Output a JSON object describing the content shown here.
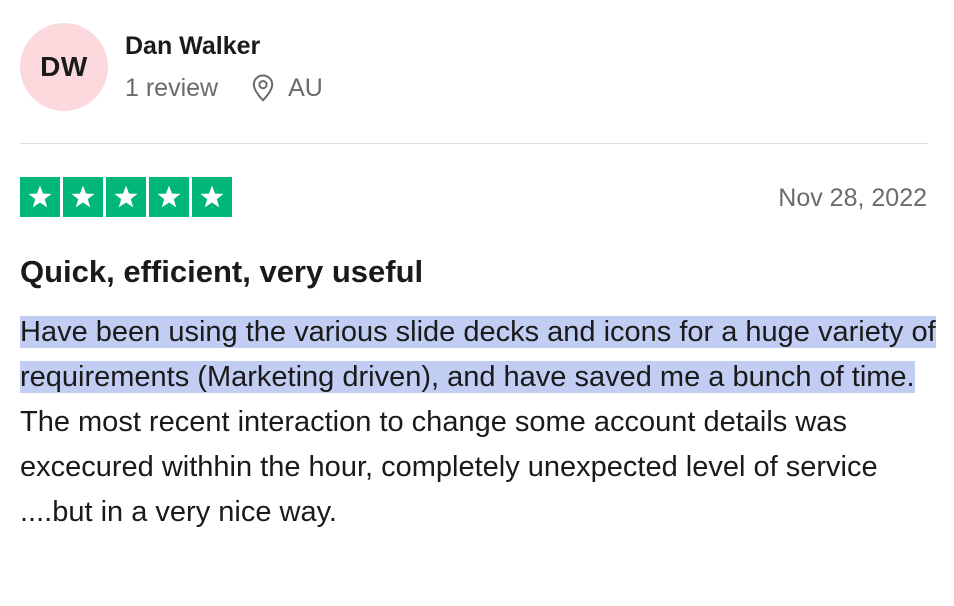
{
  "user": {
    "initials": "DW",
    "name": "Dan Walker",
    "reviews_count": "1 review",
    "location": "AU",
    "location_icon": "map-pin-icon",
    "avatar_color": "#fcd9dd"
  },
  "review": {
    "rating": 5,
    "rating_max": 5,
    "star_icon": "star-icon",
    "star_color": "#00b67a",
    "date": "Nov 28, 2022",
    "title": "Quick, efficient, very useful",
    "body_selected": "Have been using the various slide decks and icons for a huge variety of requirements (Marketing driven), and have saved me a bunch of time.",
    "body_rest": " The most recent interaction to change some account details was excecured withhin the hour, completely unexpected level of service ....but in a very nice way.",
    "selection_color": "#c1cdf2"
  }
}
